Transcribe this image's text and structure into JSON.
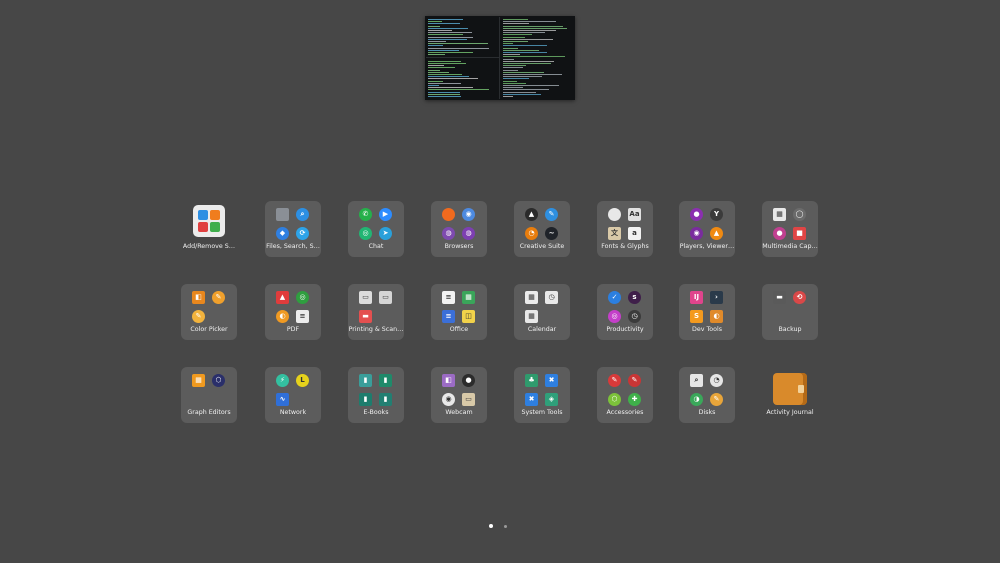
{
  "colors": {
    "background": "#474747",
    "folder": "#5c5c5c",
    "label": "#f0f0f0"
  },
  "workspace": {
    "name": "terminal-workspace-thumbnail"
  },
  "apps": [
    {
      "label": "Add/Remove S…",
      "kind": "single",
      "big": "addremove",
      "icons": []
    },
    {
      "label": "Files, Search, S…",
      "kind": "folder",
      "icons": [
        {
          "name": "file-cabinet-icon",
          "color": "#8a8f96",
          "sq": true,
          "glyph": ""
        },
        {
          "name": "search-app-icon",
          "color": "#2c8fe3",
          "sq": false,
          "glyph": "⌕"
        },
        {
          "name": "dropbox-icon",
          "color": "#2f7fe0",
          "sq": false,
          "glyph": "◆"
        },
        {
          "name": "sync-icon",
          "color": "#2da3e8",
          "sq": false,
          "glyph": "⟳"
        }
      ]
    },
    {
      "label": "Chat",
      "kind": "folder",
      "icons": [
        {
          "name": "whatsapp-icon",
          "color": "#25b04a",
          "sq": false,
          "glyph": "✆"
        },
        {
          "name": "zoom-icon",
          "color": "#2d8cff",
          "sq": false,
          "glyph": "▶"
        },
        {
          "name": "signal-icon",
          "color": "#22b573",
          "sq": false,
          "glyph": "◎"
        },
        {
          "name": "telegram-icon",
          "color": "#2aa0da",
          "sq": false,
          "glyph": "➤"
        }
      ]
    },
    {
      "label": "Browsers",
      "kind": "folder",
      "icons": [
        {
          "name": "firefox-icon",
          "color": "#f06a1e",
          "sq": false,
          "glyph": ""
        },
        {
          "name": "chromium-icon",
          "color": "#4d8ae0",
          "sq": false,
          "glyph": "◉"
        },
        {
          "name": "tor-browser-icon",
          "color": "#7e4ab0",
          "sq": false,
          "glyph": "◍"
        },
        {
          "name": "tor-icon",
          "color": "#7d3fb2",
          "sq": false,
          "glyph": "◍"
        }
      ]
    },
    {
      "label": "Creative Suite",
      "kind": "folder",
      "icons": [
        {
          "name": "inkscape-icon",
          "color": "#2b2b2b",
          "sq": false,
          "glyph": "▲"
        },
        {
          "name": "krita-icon",
          "color": "#2e8fe0",
          "sq": false,
          "glyph": "✎"
        },
        {
          "name": "blender-icon",
          "color": "#e87d0d",
          "sq": false,
          "glyph": "◔"
        },
        {
          "name": "darktable-icon",
          "color": "#1f2329",
          "sq": false,
          "glyph": "~"
        }
      ]
    },
    {
      "label": "Fonts & Glyphs",
      "kind": "folder",
      "icons": [
        {
          "name": "font-manager-icon",
          "color": "#e8e8e8",
          "sq": false,
          "glyph": ""
        },
        {
          "name": "glyphs-icon",
          "color": "#e0e0e0",
          "sq": true,
          "glyph": "Aa"
        },
        {
          "name": "character-map-icon",
          "color": "#d9c9a8",
          "sq": true,
          "glyph": "文"
        },
        {
          "name": "font-viewer-icon",
          "color": "#f2f2f2",
          "sq": true,
          "glyph": "a"
        }
      ]
    },
    {
      "label": "Players, Viewer…",
      "kind": "folder",
      "icons": [
        {
          "name": "music-player-icon",
          "color": "#8b2fb0",
          "sq": false,
          "glyph": "●"
        },
        {
          "name": "cocktail-icon",
          "color": "#3b3b3b",
          "sq": false,
          "glyph": "Y"
        },
        {
          "name": "audio-player-icon",
          "color": "#7a2c9e",
          "sq": false,
          "glyph": "◉"
        },
        {
          "name": "vlc-icon",
          "color": "#f08a12",
          "sq": false,
          "glyph": "▲"
        }
      ]
    },
    {
      "label": "Multimedia Cap…",
      "kind": "folder",
      "icons": [
        {
          "name": "screenshot-icon",
          "color": "#e8e8e8",
          "sq": true,
          "glyph": "▦"
        },
        {
          "name": "camera-icon",
          "color": "#6b6b6b",
          "sq": false,
          "glyph": "◯"
        },
        {
          "name": "obs-icon",
          "color": "#c04090",
          "sq": false,
          "glyph": "●"
        },
        {
          "name": "screen-recorder-icon",
          "color": "#e04545",
          "sq": true,
          "glyph": "■"
        }
      ]
    },
    {
      "label": "Color Picker",
      "kind": "folder",
      "icons": [
        {
          "name": "gpick-icon",
          "color": "#e8871e",
          "sq": true,
          "glyph": "◧"
        },
        {
          "name": "eyedropper-icon",
          "color": "#f0a02c",
          "sq": false,
          "glyph": "✎"
        },
        {
          "name": "color-picker-icon",
          "color": "#f2b33d",
          "sq": false,
          "glyph": "✎"
        }
      ]
    },
    {
      "label": "PDF",
      "kind": "folder",
      "icons": [
        {
          "name": "pdf-reader-icon",
          "color": "#e03c3c",
          "sq": true,
          "glyph": "▲"
        },
        {
          "name": "pdf-arranger-icon",
          "color": "#2f9e3f",
          "sq": false,
          "glyph": "◎"
        },
        {
          "name": "pdf-tools-icon",
          "color": "#f09a22",
          "sq": false,
          "glyph": "◐"
        },
        {
          "name": "document-viewer-icon",
          "color": "#ececec",
          "sq": true,
          "glyph": "≡"
        }
      ]
    },
    {
      "label": "Printing & Scan…",
      "kind": "folder",
      "icons": [
        {
          "name": "printer-icon",
          "color": "#dcdcdc",
          "sq": true,
          "glyph": "▭"
        },
        {
          "name": "scanner-icon",
          "color": "#d5d5d5",
          "sq": true,
          "glyph": "▭"
        },
        {
          "name": "print-queue-icon",
          "color": "#e45050",
          "sq": true,
          "glyph": "▬"
        }
      ]
    },
    {
      "label": "Office",
      "kind": "folder",
      "icons": [
        {
          "name": "writer-icon",
          "color": "#f2f2f2",
          "sq": true,
          "glyph": "≡"
        },
        {
          "name": "calc-icon",
          "color": "#3aa55a",
          "sq": true,
          "glyph": "▦"
        },
        {
          "name": "docs-icon",
          "color": "#3b6fd8",
          "sq": true,
          "glyph": "≡"
        },
        {
          "name": "impress-icon",
          "color": "#f2d24a",
          "sq": true,
          "glyph": "◫"
        }
      ]
    },
    {
      "label": "Calendar",
      "kind": "folder",
      "icons": [
        {
          "name": "calendar-icon",
          "color": "#ececec",
          "sq": true,
          "glyph": "▦"
        },
        {
          "name": "calendar-alt-icon",
          "color": "#e9e9e9",
          "sq": true,
          "glyph": "◷"
        },
        {
          "name": "planner-icon",
          "color": "#e8e8e8",
          "sq": true,
          "glyph": "▦"
        }
      ]
    },
    {
      "label": "Productivity",
      "kind": "folder",
      "icons": [
        {
          "name": "todo-icon",
          "color": "#2b7fe0",
          "sq": false,
          "glyph": "✓"
        },
        {
          "name": "slack-icon",
          "color": "#3f1f4a",
          "sq": false,
          "glyph": "s"
        },
        {
          "name": "pomodoro-icon",
          "color": "#c43fc9",
          "sq": false,
          "glyph": "◎"
        },
        {
          "name": "clock-icon",
          "color": "#3b3b3b",
          "sq": false,
          "glyph": "◷"
        }
      ]
    },
    {
      "label": "Dev Tools",
      "kind": "folder",
      "icons": [
        {
          "name": "ide-icon",
          "color": "#e0448c",
          "sq": true,
          "glyph": "IJ"
        },
        {
          "name": "terminal-app-icon",
          "color": "#2a3a4a",
          "sq": true,
          "glyph": "›"
        },
        {
          "name": "sublime-icon",
          "color": "#f49a1e",
          "sq": true,
          "glyph": "S"
        },
        {
          "name": "diff-tool-icon",
          "color": "#e08a2a",
          "sq": true,
          "glyph": "◐"
        }
      ]
    },
    {
      "label": "Backup",
      "kind": "folder",
      "icons": [
        {
          "name": "backup-tool-icon",
          "color": "#5a5a5a",
          "sq": true,
          "glyph": "▬"
        },
        {
          "name": "timeshift-icon",
          "color": "#d94848",
          "sq": false,
          "glyph": "⟲"
        }
      ]
    },
    {
      "label": "Graph Editors",
      "kind": "folder",
      "icons": [
        {
          "name": "diagram-editor-icon",
          "color": "#f09a1f",
          "sq": true,
          "glyph": "▦"
        },
        {
          "name": "graph-tool-icon",
          "color": "#2a2f6a",
          "sq": false,
          "glyph": "⬡"
        }
      ]
    },
    {
      "label": "Network",
      "kind": "folder",
      "icons": [
        {
          "name": "network-monitor-icon",
          "color": "#33c0a0",
          "sq": false,
          "glyph": "⚡"
        },
        {
          "name": "wireshark-icon",
          "color": "#e6d21c",
          "sq": false,
          "glyph": "L"
        },
        {
          "name": "network-tool-icon",
          "color": "#2f6fd8",
          "sq": true,
          "glyph": "∿"
        }
      ]
    },
    {
      "label": "E-Books",
      "kind": "folder",
      "icons": [
        {
          "name": "ebook-reader-icon",
          "color": "#3a9e9a",
          "sq": true,
          "glyph": "▮"
        },
        {
          "name": "ebook-library-icon",
          "color": "#1f8a6a",
          "sq": true,
          "glyph": "▮"
        },
        {
          "name": "ebook-viewer-icon",
          "color": "#1d7d6d",
          "sq": true,
          "glyph": "▮"
        },
        {
          "name": "ebook-editor-icon",
          "color": "#227f72",
          "sq": true,
          "glyph": "▮"
        }
      ]
    },
    {
      "label": "Webcam",
      "kind": "folder",
      "icons": [
        {
          "name": "webcam-app-icon",
          "color": "#9b6bc4",
          "sq": true,
          "glyph": "◧"
        },
        {
          "name": "record-icon",
          "color": "#2c2c2c",
          "sq": false,
          "glyph": "●"
        },
        {
          "name": "webcam-viewer-icon",
          "color": "#e8e8e8",
          "sq": false,
          "glyph": "◉"
        },
        {
          "name": "camera-control-icon",
          "color": "#d8c9a8",
          "sq": true,
          "glyph": "▭"
        }
      ]
    },
    {
      "label": "System Tools",
      "kind": "folder",
      "icons": [
        {
          "name": "system-monitor-icon",
          "color": "#2f9b6d",
          "sq": true,
          "glyph": "♣"
        },
        {
          "name": "system-settings-icon",
          "color": "#2e7fe0",
          "sq": true,
          "glyph": "✖"
        },
        {
          "name": "system-info-icon",
          "color": "#2e7fe0",
          "sq": true,
          "glyph": "✖"
        },
        {
          "name": "system-package-icon",
          "color": "#2fa07a",
          "sq": true,
          "glyph": "◈"
        }
      ]
    },
    {
      "label": "Accessories",
      "kind": "folder",
      "icons": [
        {
          "name": "screwdriver-icon",
          "color": "#d83a3a",
          "sq": false,
          "glyph": "✎"
        },
        {
          "name": "wrench-icon",
          "color": "#c93535",
          "sq": false,
          "glyph": "✎"
        },
        {
          "name": "package-icon",
          "color": "#7cc23a",
          "sq": false,
          "glyph": "⬡"
        },
        {
          "name": "puzzle-icon",
          "color": "#3fb04a",
          "sq": false,
          "glyph": "✚"
        }
      ]
    },
    {
      "label": "Disks",
      "kind": "folder",
      "icons": [
        {
          "name": "disk-usage-icon",
          "color": "#e6e6e6",
          "sq": true,
          "glyph": "⌕"
        },
        {
          "name": "disk-analyzer-icon",
          "color": "#e6e6e6",
          "sq": false,
          "glyph": "◔"
        },
        {
          "name": "partition-icon",
          "color": "#3aa85a",
          "sq": false,
          "glyph": "◑"
        },
        {
          "name": "disk-cleaner-icon",
          "color": "#e8a53a",
          "sq": false,
          "glyph": "✎"
        }
      ]
    },
    {
      "label": "Activity Journal",
      "kind": "single",
      "big": "journal",
      "icons": []
    }
  ],
  "pages": [
    {
      "active": true
    },
    {
      "active": false
    }
  ]
}
